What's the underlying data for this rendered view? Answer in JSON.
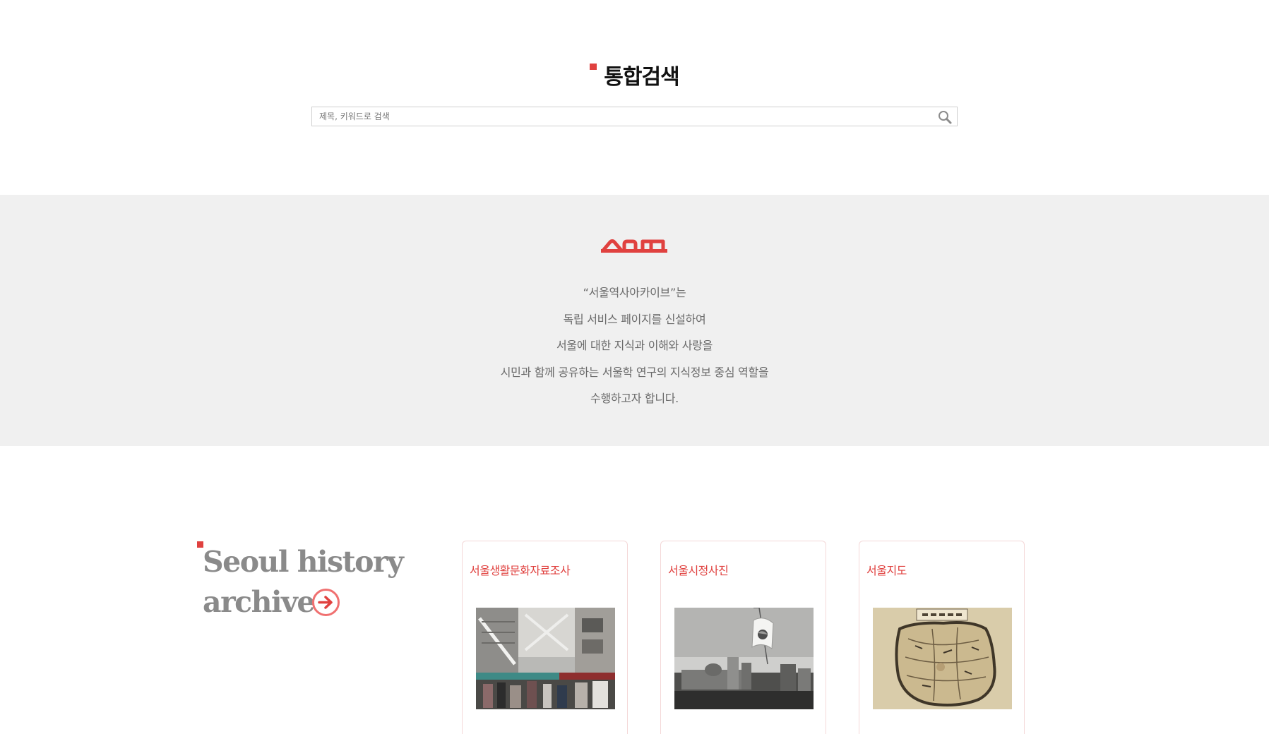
{
  "search": {
    "title": "통합검색",
    "placeholder": "제목, 키워드로 검색"
  },
  "intro": {
    "lines": [
      "“서울역사아카이브”는",
      "독립 서비스 페이지를 신설하여",
      "서울에 대한 지식과 이해와 사랑을",
      "시민과 함께 공유하는 서울학 연구의 지식정보 중심 역할을",
      "수행하고자 합니다."
    ]
  },
  "archive": {
    "heading_line1": "Seoul history",
    "heading_line2": "archive",
    "cards": [
      {
        "title": "서울생활문화자료조사"
      },
      {
        "title": "서울시정사진"
      },
      {
        "title": "서울지도"
      }
    ]
  },
  "colors": {
    "accent": "#e0413f",
    "band": "#f0f0f0",
    "heading_gray": "#8a8a8a"
  },
  "icons": {
    "search": "search-icon",
    "logo": "seoul-logo",
    "arrow": "arrow-right-circle-icon"
  }
}
